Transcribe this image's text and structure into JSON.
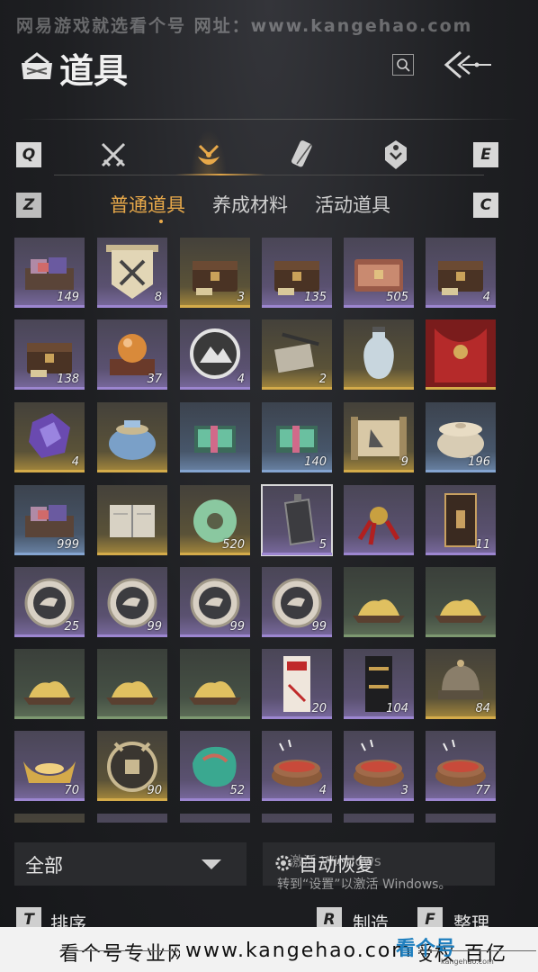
{
  "watermark_top": "网易游戏就选看个号  网址：www.kangehao.com",
  "header": {
    "title": "道具"
  },
  "tabs": {
    "prev_key": "Q",
    "next_key": "E"
  },
  "subtabs": {
    "prev_key": "Z",
    "next_key": "C",
    "items": [
      "普通道具",
      "养成材料",
      "活动道具"
    ]
  },
  "items": [
    {
      "count": "149",
      "rarity": "purple",
      "icon": "cloth-tray-icon"
    },
    {
      "count": "8",
      "rarity": "purple",
      "icon": "banner-swords-icon"
    },
    {
      "count": "3",
      "rarity": "gold",
      "icon": "chest-icon"
    },
    {
      "count": "135",
      "rarity": "purple",
      "icon": "chest-icon"
    },
    {
      "count": "505",
      "rarity": "purple",
      "icon": "carved-chest-icon"
    },
    {
      "count": "4",
      "rarity": "purple",
      "icon": "chest-icon"
    },
    {
      "count": "138",
      "rarity": "purple",
      "icon": "chest-icon"
    },
    {
      "count": "37",
      "rarity": "purple",
      "icon": "orb-pedestal-icon"
    },
    {
      "count": "4",
      "rarity": "purple",
      "icon": "mountain-token-icon"
    },
    {
      "count": "2",
      "rarity": "gold",
      "icon": "scroll-brush-icon"
    },
    {
      "count": "",
      "rarity": "gold",
      "icon": "vase-icon"
    },
    {
      "count": "",
      "rarity": "gold",
      "icon": "red-cloth-icon"
    },
    {
      "count": "4",
      "rarity": "gold",
      "icon": "crystal-icon"
    },
    {
      "count": "",
      "rarity": "gold",
      "icon": "jar-icon"
    },
    {
      "count": "",
      "rarity": "blue",
      "icon": "gift-box-icon"
    },
    {
      "count": "140",
      "rarity": "blue",
      "icon": "gift-box-icon"
    },
    {
      "count": "9",
      "rarity": "gold",
      "icon": "scroll-icon"
    },
    {
      "count": "196",
      "rarity": "blue",
      "icon": "pot-icon"
    },
    {
      "count": "999",
      "rarity": "blue",
      "icon": "cloth-tray-icon"
    },
    {
      "count": "",
      "rarity": "gold",
      "icon": "book-icon"
    },
    {
      "count": "520",
      "rarity": "gold",
      "icon": "jade-ring-icon"
    },
    {
      "count": "5",
      "rarity": "purple",
      "icon": "pendant-icon",
      "selected": true
    },
    {
      "count": "",
      "rarity": "purple",
      "icon": "red-knot-icon"
    },
    {
      "count": "11",
      "rarity": "purple",
      "icon": "plaque-icon"
    },
    {
      "count": "25",
      "rarity": "purple",
      "icon": "bird-coin-icon"
    },
    {
      "count": "99",
      "rarity": "purple",
      "icon": "bird-coin-icon"
    },
    {
      "count": "99",
      "rarity": "purple",
      "icon": "bird-coin-icon"
    },
    {
      "count": "99",
      "rarity": "purple",
      "icon": "bird-coin-icon"
    },
    {
      "count": "",
      "rarity": "green",
      "icon": "gold-pile-icon"
    },
    {
      "count": "",
      "rarity": "green",
      "icon": "gold-pile-icon"
    },
    {
      "count": "",
      "rarity": "green",
      "icon": "gold-pile-icon"
    },
    {
      "count": "",
      "rarity": "green",
      "icon": "gold-pile-icon"
    },
    {
      "count": "",
      "rarity": "green",
      "icon": "gold-pile-icon"
    },
    {
      "count": "20",
      "rarity": "purple",
      "icon": "red-ticket-icon"
    },
    {
      "count": "104",
      "rarity": "purple",
      "icon": "black-ticket-icon"
    },
    {
      "count": "84",
      "rarity": "gold",
      "icon": "helmet-icon"
    },
    {
      "count": "70",
      "rarity": "purple",
      "icon": "gold-ingot-icon"
    },
    {
      "count": "90",
      "rarity": "gold",
      "icon": "coin-icon"
    },
    {
      "count": "52",
      "rarity": "purple",
      "icon": "jade-stone-icon"
    },
    {
      "count": "4",
      "rarity": "purple",
      "icon": "food-bowl-icon"
    },
    {
      "count": "3",
      "rarity": "purple",
      "icon": "food-bowl-icon"
    },
    {
      "count": "77",
      "rarity": "purple",
      "icon": "food-bowl-icon"
    }
  ],
  "filter": {
    "label": "全部"
  },
  "auto_restore": {
    "label": "自动恢复"
  },
  "windows_activation": {
    "line1": "激活 Windows",
    "line2": "转到“设置”以激活 Windows。"
  },
  "bottom": {
    "sort": {
      "key": "T",
      "label": "排序"
    },
    "craft": {
      "key": "R",
      "label": "制造"
    },
    "arrange": {
      "key": "F",
      "label": "整理"
    }
  },
  "footer_watermark": {
    "text": "看个号专业网易游戏代售  每家号合法授权  百亿",
    "url": "www.kangehao.com",
    "logo": "看个号",
    "logo_sub": "kangehao.com"
  }
}
